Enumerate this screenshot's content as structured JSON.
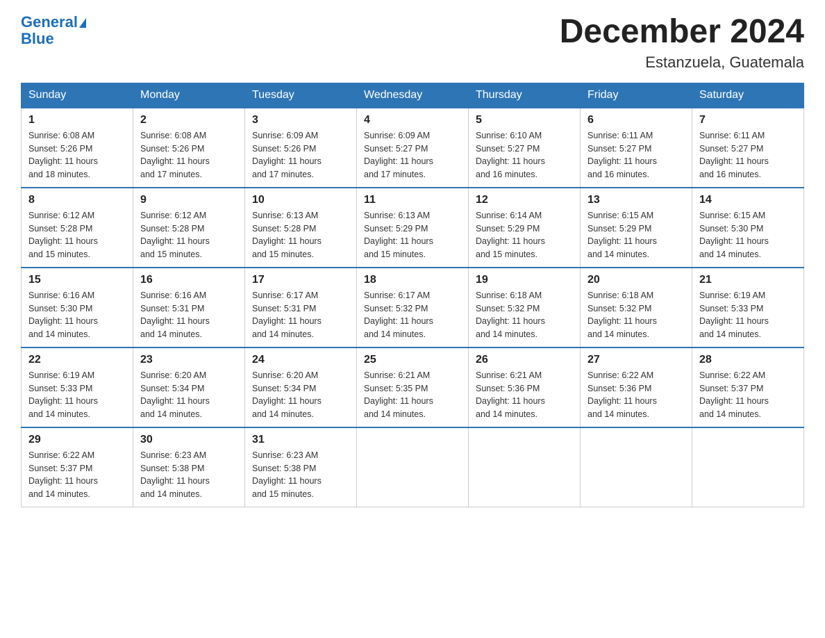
{
  "header": {
    "logo_general": "General",
    "logo_blue": "Blue",
    "title": "December 2024",
    "subtitle": "Estanzuela, Guatemala"
  },
  "days_of_week": [
    "Sunday",
    "Monday",
    "Tuesday",
    "Wednesday",
    "Thursday",
    "Friday",
    "Saturday"
  ],
  "weeks": [
    [
      {
        "day": "1",
        "sunrise": "6:08 AM",
        "sunset": "5:26 PM",
        "daylight": "11 hours and 18 minutes."
      },
      {
        "day": "2",
        "sunrise": "6:08 AM",
        "sunset": "5:26 PM",
        "daylight": "11 hours and 17 minutes."
      },
      {
        "day": "3",
        "sunrise": "6:09 AM",
        "sunset": "5:26 PM",
        "daylight": "11 hours and 17 minutes."
      },
      {
        "day": "4",
        "sunrise": "6:09 AM",
        "sunset": "5:27 PM",
        "daylight": "11 hours and 17 minutes."
      },
      {
        "day": "5",
        "sunrise": "6:10 AM",
        "sunset": "5:27 PM",
        "daylight": "11 hours and 16 minutes."
      },
      {
        "day": "6",
        "sunrise": "6:11 AM",
        "sunset": "5:27 PM",
        "daylight": "11 hours and 16 minutes."
      },
      {
        "day": "7",
        "sunrise": "6:11 AM",
        "sunset": "5:27 PM",
        "daylight": "11 hours and 16 minutes."
      }
    ],
    [
      {
        "day": "8",
        "sunrise": "6:12 AM",
        "sunset": "5:28 PM",
        "daylight": "11 hours and 15 minutes."
      },
      {
        "day": "9",
        "sunrise": "6:12 AM",
        "sunset": "5:28 PM",
        "daylight": "11 hours and 15 minutes."
      },
      {
        "day": "10",
        "sunrise": "6:13 AM",
        "sunset": "5:28 PM",
        "daylight": "11 hours and 15 minutes."
      },
      {
        "day": "11",
        "sunrise": "6:13 AM",
        "sunset": "5:29 PM",
        "daylight": "11 hours and 15 minutes."
      },
      {
        "day": "12",
        "sunrise": "6:14 AM",
        "sunset": "5:29 PM",
        "daylight": "11 hours and 15 minutes."
      },
      {
        "day": "13",
        "sunrise": "6:15 AM",
        "sunset": "5:29 PM",
        "daylight": "11 hours and 14 minutes."
      },
      {
        "day": "14",
        "sunrise": "6:15 AM",
        "sunset": "5:30 PM",
        "daylight": "11 hours and 14 minutes."
      }
    ],
    [
      {
        "day": "15",
        "sunrise": "6:16 AM",
        "sunset": "5:30 PM",
        "daylight": "11 hours and 14 minutes."
      },
      {
        "day": "16",
        "sunrise": "6:16 AM",
        "sunset": "5:31 PM",
        "daylight": "11 hours and 14 minutes."
      },
      {
        "day": "17",
        "sunrise": "6:17 AM",
        "sunset": "5:31 PM",
        "daylight": "11 hours and 14 minutes."
      },
      {
        "day": "18",
        "sunrise": "6:17 AM",
        "sunset": "5:32 PM",
        "daylight": "11 hours and 14 minutes."
      },
      {
        "day": "19",
        "sunrise": "6:18 AM",
        "sunset": "5:32 PM",
        "daylight": "11 hours and 14 minutes."
      },
      {
        "day": "20",
        "sunrise": "6:18 AM",
        "sunset": "5:32 PM",
        "daylight": "11 hours and 14 minutes."
      },
      {
        "day": "21",
        "sunrise": "6:19 AM",
        "sunset": "5:33 PM",
        "daylight": "11 hours and 14 minutes."
      }
    ],
    [
      {
        "day": "22",
        "sunrise": "6:19 AM",
        "sunset": "5:33 PM",
        "daylight": "11 hours and 14 minutes."
      },
      {
        "day": "23",
        "sunrise": "6:20 AM",
        "sunset": "5:34 PM",
        "daylight": "11 hours and 14 minutes."
      },
      {
        "day": "24",
        "sunrise": "6:20 AM",
        "sunset": "5:34 PM",
        "daylight": "11 hours and 14 minutes."
      },
      {
        "day": "25",
        "sunrise": "6:21 AM",
        "sunset": "5:35 PM",
        "daylight": "11 hours and 14 minutes."
      },
      {
        "day": "26",
        "sunrise": "6:21 AM",
        "sunset": "5:36 PM",
        "daylight": "11 hours and 14 minutes."
      },
      {
        "day": "27",
        "sunrise": "6:22 AM",
        "sunset": "5:36 PM",
        "daylight": "11 hours and 14 minutes."
      },
      {
        "day": "28",
        "sunrise": "6:22 AM",
        "sunset": "5:37 PM",
        "daylight": "11 hours and 14 minutes."
      }
    ],
    [
      {
        "day": "29",
        "sunrise": "6:22 AM",
        "sunset": "5:37 PM",
        "daylight": "11 hours and 14 minutes."
      },
      {
        "day": "30",
        "sunrise": "6:23 AM",
        "sunset": "5:38 PM",
        "daylight": "11 hours and 14 minutes."
      },
      {
        "day": "31",
        "sunrise": "6:23 AM",
        "sunset": "5:38 PM",
        "daylight": "11 hours and 15 minutes."
      },
      null,
      null,
      null,
      null
    ]
  ],
  "labels": {
    "sunrise": "Sunrise:",
    "sunset": "Sunset:",
    "daylight": "Daylight:"
  }
}
